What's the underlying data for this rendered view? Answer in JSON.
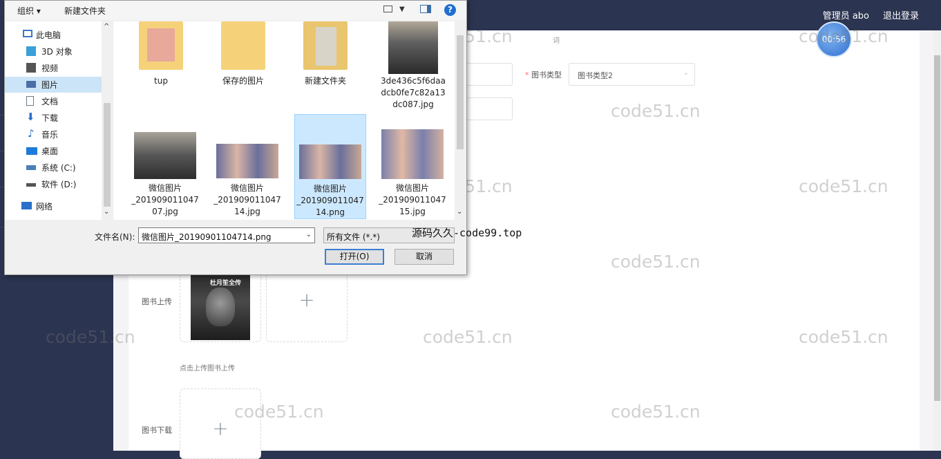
{
  "app": {
    "user": "管理员 abo",
    "logout": "退出登录",
    "avatar_text": "00:56",
    "form": {
      "type_label": "图书类型",
      "type_value": "图书类型2",
      "small_label": "词",
      "upload_label": "图书上传",
      "upload_hint": "点击上传图书上传",
      "download_label": "图书下载",
      "cover_title": "杜月笙全传"
    }
  },
  "dialog": {
    "toolbar": {
      "organize": "组织 ▾",
      "new_folder": "新建文件夹"
    },
    "nav": [
      {
        "label": "此电脑",
        "icon": "computer-icon",
        "color": "#3a78c9"
      },
      {
        "label": "3D 对象",
        "icon": "cube-icon",
        "color": "#3aa0d8"
      },
      {
        "label": "视频",
        "icon": "video-icon",
        "color": "#555555"
      },
      {
        "label": "图片",
        "icon": "picture-icon",
        "color": "#4a6ea8",
        "selected": true
      },
      {
        "label": "文档",
        "icon": "document-icon",
        "color": "#6a7a8a"
      },
      {
        "label": "下载",
        "icon": "download-icon",
        "color": "#2a6fc9"
      },
      {
        "label": "音乐",
        "icon": "music-icon",
        "color": "#2a6fc9"
      },
      {
        "label": "桌面",
        "icon": "desktop-icon",
        "color": "#1e7ad9"
      },
      {
        "label": "系统 (C:)",
        "icon": "drive-icon",
        "color": "#4a7fb8"
      },
      {
        "label": "软件 (D:)",
        "icon": "drive-icon",
        "color": "#555555"
      },
      {
        "label": "网络",
        "icon": "network-icon",
        "color": "#2a6fc9"
      }
    ],
    "files": [
      {
        "name": "tup",
        "kind": "folder"
      },
      {
        "name": "保存的图片",
        "kind": "folder"
      },
      {
        "name": "新建文件夹",
        "kind": "folder"
      },
      {
        "name": "3de436c5f6daa dcb0fe7c82a13 dc087.jpg",
        "kind": "photo"
      },
      {
        "name": "微信图片 _201909011047 07.jpg",
        "kind": "photo"
      },
      {
        "name": "微信图片 _201909011047 14.jpg",
        "kind": "photo"
      },
      {
        "name": "微信图片 _201909011047 14.png",
        "kind": "photo",
        "selected": true
      },
      {
        "name": "微信图片 _201909011047 15.jpg",
        "kind": "photo"
      }
    ],
    "filename_label": "文件名(N):",
    "filename_value": "微信图片_20190901104714.png",
    "filter_value": "所有文件 (*.*)",
    "open_label": "打开(O)",
    "cancel_label": "取消"
  },
  "watermark": {
    "text": "code51.cn",
    "overlay": "源码久久-code99.top"
  }
}
